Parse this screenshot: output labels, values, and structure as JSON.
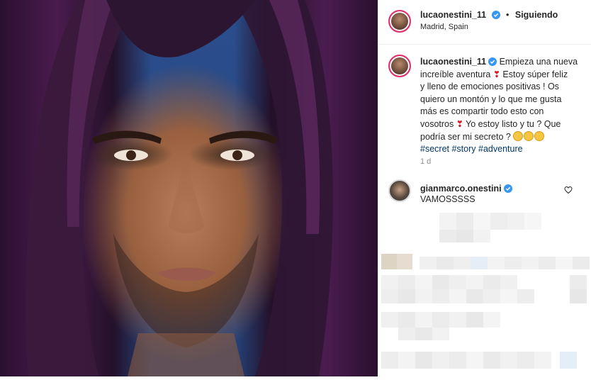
{
  "post": {
    "author": {
      "username": "lucaonestini_11",
      "verified": true,
      "follow_state": "Siguiendo",
      "dot": "•",
      "location": "Madrid, Spain"
    },
    "caption": {
      "username": "lucaonestini_11",
      "line1": "Empieza una nueva",
      "line2": "increíble aventura",
      "line3": "Estoy súper feliz",
      "line4": "y lleno de emociones positivas ! Os",
      "line5": "quiero un montón y lo que me gusta",
      "line6": "más es compartir todo esto con",
      "line7a": "vosotros",
      "line7b": "Yo estoy listo y tu ? Que",
      "line8": "podría ser mi secreto ?",
      "hashtags": [
        "#secret",
        "#story",
        "#adventure"
      ],
      "age": "1 d",
      "emoji_heart": "❣",
      "emoji_faces": [
        "grimace-face",
        "wink-kiss-face",
        "smirk-face"
      ]
    },
    "comments": [
      {
        "username": "gianmarco.onestini",
        "verified": true,
        "text": "VAMOSSSSS",
        "icon": "heart-outline-icon"
      }
    ]
  },
  "colors": {
    "verified_badge": "#3897f0",
    "story_ring": "#e1306c",
    "hashtag": "#00376b",
    "meta_gray": "#8e8e8e"
  }
}
